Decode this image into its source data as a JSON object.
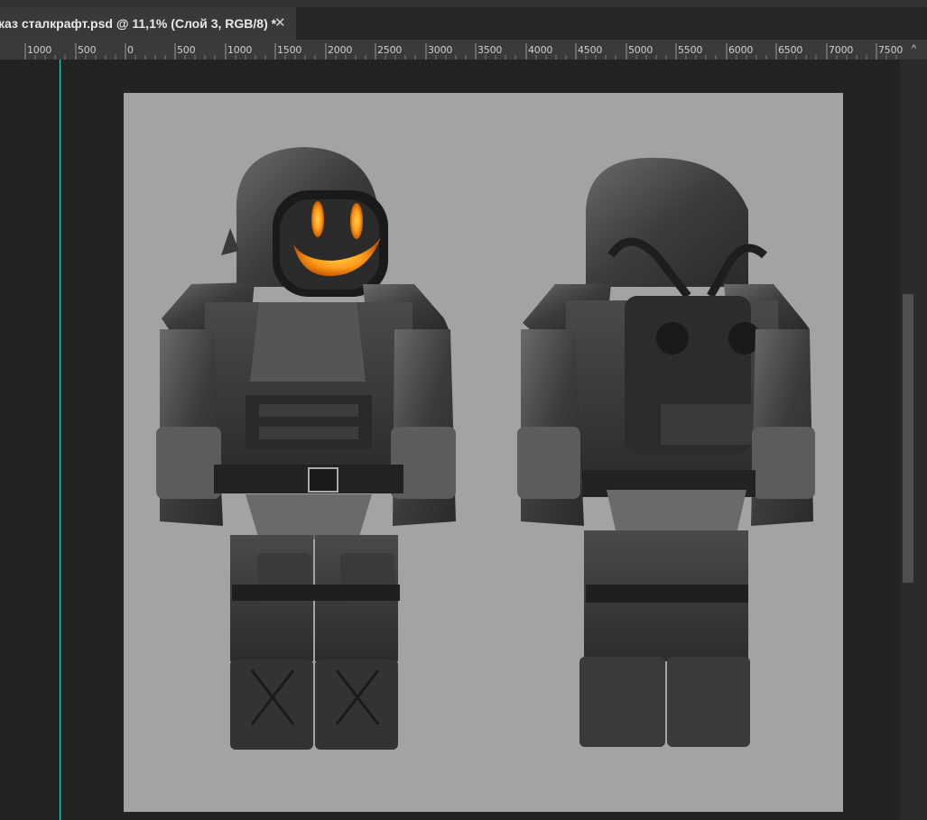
{
  "document_tab": {
    "title": "каз сталкрафт.psd @ 11,1% (Слой 3, RGB/8) *",
    "close_glyph": "✕"
  },
  "ruler": {
    "labels": [
      "1000",
      "500",
      "0",
      "500",
      "1000",
      "1500",
      "2000",
      "2500",
      "3000",
      "3500",
      "4000",
      "4500",
      "5000",
      "5500",
      "6000",
      "6500",
      "7000",
      "7500"
    ],
    "scroll_glyph": "^"
  },
  "canvas": {
    "background": "#a3a3a3",
    "content": "stalker character render front and back"
  },
  "colors": {
    "accent_guide": "#35d0d0",
    "visor_glow": "#ff9a1a"
  }
}
